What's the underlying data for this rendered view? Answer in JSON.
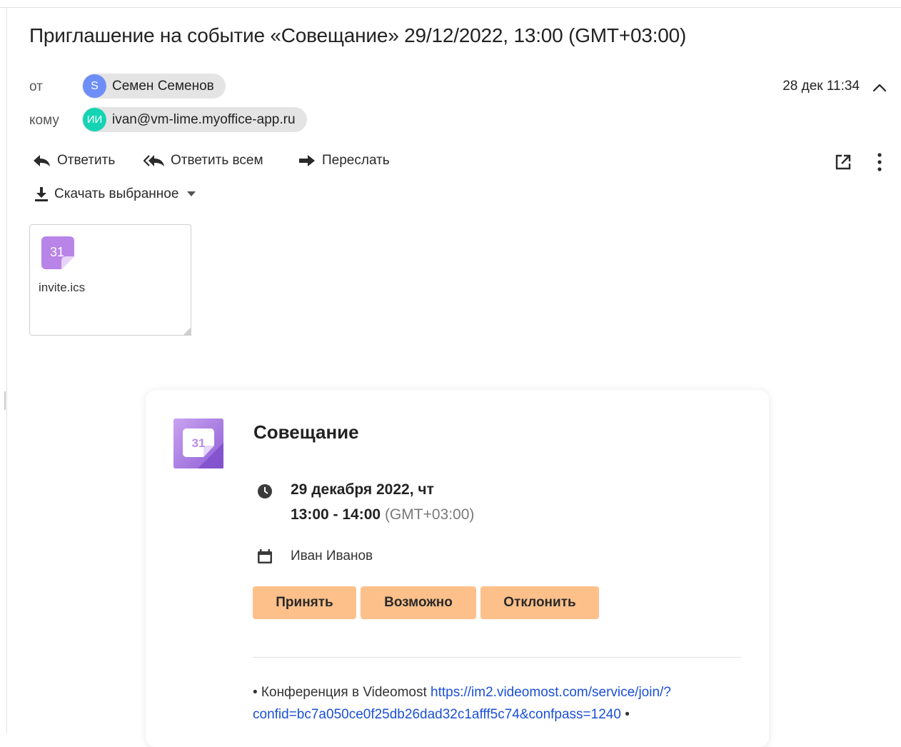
{
  "subject": "Приглашение на событие «Совещание» 29/12/2022, 13:00 (GMT+03:00)",
  "from": {
    "label": "от",
    "initials": "S",
    "name": "Семен Семенов",
    "avatar_color": "#6e8ef7"
  },
  "to": {
    "label": "кому",
    "initials": "ИИ",
    "email": "ivan@vm-lime.myoffice-app.ru",
    "avatar_color": "#14d4b4"
  },
  "date": "28 дек 11:34",
  "actions": {
    "reply": "Ответить",
    "reply_all": "Ответить всем",
    "forward": "Переслать",
    "download_selected": "Скачать выбранное"
  },
  "attachment": {
    "icon_number": "31",
    "filename": "invite.ics"
  },
  "event": {
    "icon_number": "31",
    "title": "Совещание",
    "date_line": "29 декабря 2022, чт",
    "time": "13:00 - 14:00",
    "timezone": "(GMT+03:00)",
    "organizer": "Иван Иванов",
    "buttons": {
      "accept": "Принять",
      "maybe": "Возможно",
      "decline": "Отклонить"
    },
    "button_color": "#fdc08a",
    "description": {
      "prefix": "• Конференция в Videomost ",
      "link_part1": "https://im2.videomost.com/service/join/?",
      "link_part2": "confid=bc7a050ce0f25db26dad32c1afff5c74&confpass=1240",
      "suffix": " •"
    }
  }
}
